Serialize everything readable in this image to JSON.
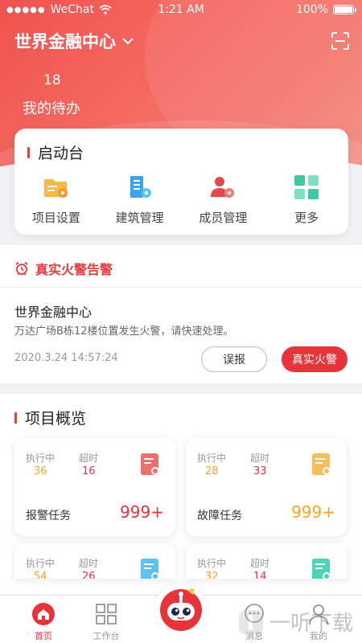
{
  "status_bar": {
    "carrier": "WeChat",
    "time": "1:21 AM",
    "battery": "100%"
  },
  "header": {
    "title": "世界金融中心",
    "todo_count": "18",
    "todo_label": "我的待办"
  },
  "launchpad": {
    "title": "启动台",
    "items": [
      {
        "label": "项目设置",
        "icon": "folder-settings-icon"
      },
      {
        "label": "建筑管理",
        "icon": "building-settings-icon"
      },
      {
        "label": "成员管理",
        "icon": "members-settings-icon"
      },
      {
        "label": "更多",
        "icon": "grid-more-icon"
      }
    ]
  },
  "alarm": {
    "header": "真实火警告警",
    "location": "世界金融中心",
    "message": "万达广场B栋12楼位置发生火警，请快速处理。",
    "time": "2020.3.24 14:57:24",
    "false_alarm_label": "误报",
    "real_alarm_label": "真实火警"
  },
  "overview": {
    "title": "项目概览",
    "cards": [
      {
        "k1": "执行中",
        "v1": "36",
        "k2": "超时",
        "v2": "16",
        "name": "报警任务",
        "total": "999+",
        "total_color": "#e8333a",
        "icon_color": "#ef6f6f"
      },
      {
        "k1": "执行中",
        "v1": "28",
        "k2": "超时",
        "v2": "33",
        "name": "故障任务",
        "total": "999+",
        "total_color": "#f5a623",
        "icon_color": "#f7bf5a"
      },
      {
        "k1": "执行中",
        "v1": "54",
        "k2": "超时",
        "v2": "26",
        "name": "",
        "total": "",
        "total_color": "#e8333a",
        "icon_color": "#5bc2ef"
      },
      {
        "k1": "执行中",
        "v1": "32",
        "k2": "超时",
        "v2": "14",
        "name": "",
        "total": "",
        "total_color": "#e8333a",
        "icon_color": "#4fd3b8"
      }
    ]
  },
  "tabbar": {
    "items": [
      {
        "label": "首页",
        "icon": "home-icon",
        "active": true
      },
      {
        "label": "工作台",
        "icon": "workbench-grid-icon",
        "active": false
      },
      {
        "label": "消息",
        "icon": "message-icon",
        "active": false
      },
      {
        "label": "我的",
        "icon": "profile-icon",
        "active": false
      }
    ],
    "center_icon": "robot-assistant-icon"
  },
  "watermark": {
    "text": "一听下载"
  },
  "colors": {
    "brand_red": "#e8333a",
    "accent_orange": "#f5a623"
  }
}
